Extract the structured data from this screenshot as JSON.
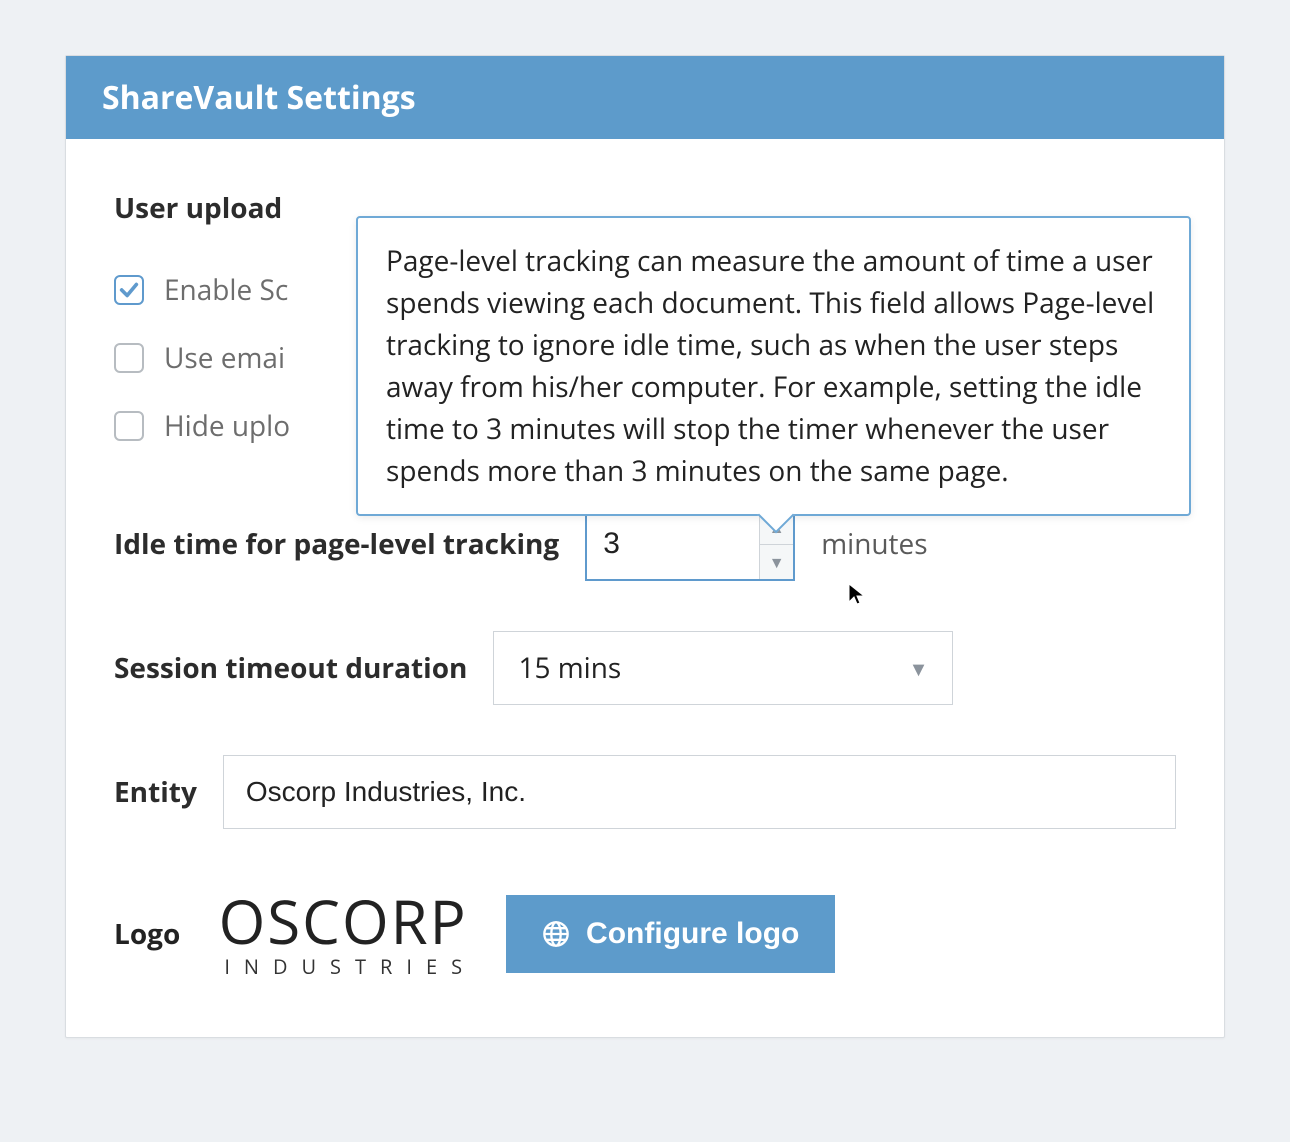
{
  "panel": {
    "title": "ShareVault Settings"
  },
  "sections": {
    "upload_heading": "User upload"
  },
  "checkboxes": {
    "enable_screen": {
      "label": "Enable Sc",
      "checked": true
    },
    "use_email": {
      "label": "Use emai",
      "checked": false
    },
    "hide_upload": {
      "label": "Hide uplo",
      "checked": false
    }
  },
  "idle": {
    "label": "Idle time for page-level tracking",
    "value": "3",
    "units": "minutes",
    "tooltip": "Page-level tracking can measure the amount of time a user spends viewing each document. This field allows Page-level tracking to ignore idle time, such as when the user steps away from his/her computer. For example, setting the idle time to 3 minutes will stop the timer whenever the user spends more than 3 minutes on the same page."
  },
  "session": {
    "label": "Session timeout duration",
    "value": "15 mins"
  },
  "entity": {
    "label": "Entity",
    "value": "Oscorp Industries, Inc."
  },
  "logo": {
    "label": "Logo",
    "brand_word": "OSCORP",
    "brand_sub": "INDUSTRIES",
    "button": "Configure logo"
  },
  "colors": {
    "accent": "#5D9BCB"
  }
}
